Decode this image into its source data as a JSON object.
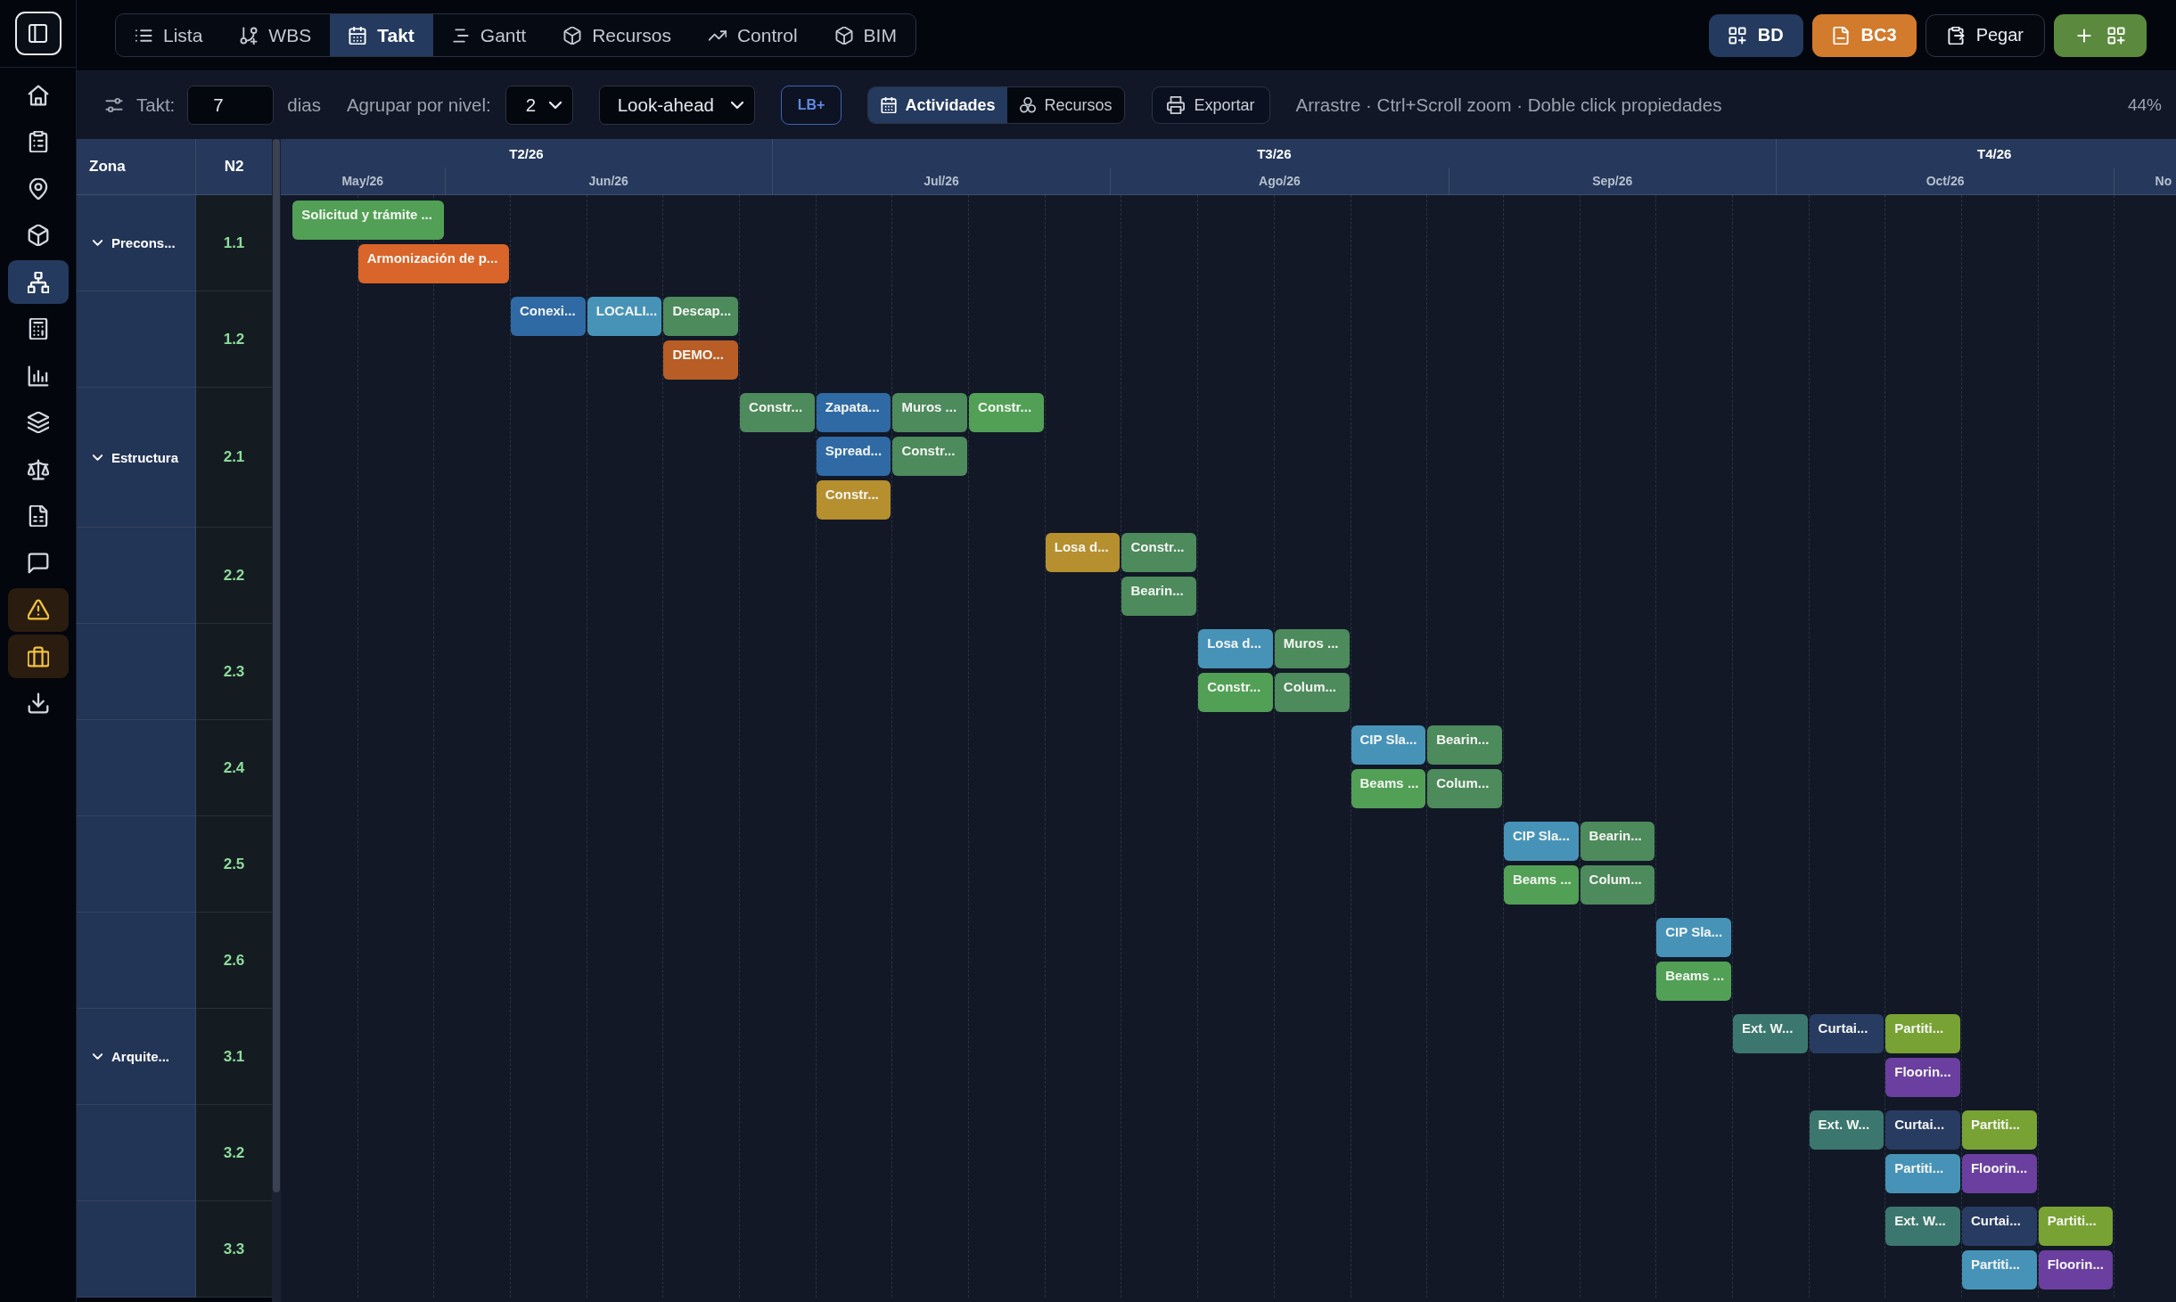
{
  "sidebar": {
    "items": [
      {
        "selected": false,
        "highlighted": false
      },
      {
        "selected": false,
        "highlighted": false
      },
      {
        "selected": false,
        "highlighted": false
      },
      {
        "selected": false,
        "highlighted": false
      },
      {
        "selected": true,
        "highlighted": false
      },
      {
        "selected": false,
        "highlighted": false
      },
      {
        "selected": false,
        "highlighted": false
      },
      {
        "selected": false,
        "highlighted": false
      },
      {
        "selected": false,
        "highlighted": false
      },
      {
        "selected": false,
        "highlighted": false
      },
      {
        "selected": false,
        "highlighted": false
      },
      {
        "selected": false,
        "highlighted": true
      },
      {
        "selected": false,
        "highlighted": true
      },
      {
        "selected": false,
        "highlighted": false
      }
    ]
  },
  "top_bar": {
    "tabs": [
      {
        "label": "Lista",
        "selected": false
      },
      {
        "label": "WBS",
        "selected": false
      },
      {
        "label": "Takt",
        "selected": true
      },
      {
        "label": "Gantt",
        "selected": false
      },
      {
        "label": "Recursos",
        "selected": false
      },
      {
        "label": "Control",
        "selected": false
      },
      {
        "label": "BIM",
        "selected": false
      }
    ],
    "actions": [
      {
        "kind": "database",
        "label": "BD"
      },
      {
        "kind": "file",
        "label": "BC3"
      },
      {
        "kind": "paste",
        "label": "Pegar"
      },
      {
        "kind": "add"
      }
    ]
  },
  "toolbar": {
    "takt": {
      "label": "Takt:",
      "value": "7",
      "unit": "dias"
    },
    "group_level": {
      "label": "Agrupar por nivel:",
      "value": "2"
    },
    "view_select": {
      "value": "Look-ahead"
    },
    "baseline_button": "LB+",
    "mode_toggle": [
      {
        "label": "Actividades",
        "selected": true
      },
      {
        "label": "Recursos",
        "selected": false
      }
    ],
    "export_button": "Exportar",
    "hint": "Arrastre · Ctrl+Scroll zoom · Doble click propiedades",
    "zoom": "44%"
  },
  "gantt": {
    "zone_header": "Zona",
    "level_header": "N2",
    "quarters": [
      "T2/26",
      "T3/26",
      "T4/26"
    ],
    "months": [
      "May/26",
      "Jun/26",
      "Jul/26",
      "Ago/26",
      "Sep/26",
      "Oct/26",
      "No"
    ],
    "groups": [
      {
        "zone": "Precons...",
        "expanded": true,
        "rows": [
          {
            "code": "1.1",
            "lanes": [
              {
                "bars": [
                  {
                    "label": "Solicitud y trámite ...",
                    "color": "#52a056"
                  }
                ]
              },
              {
                "bars": [
                  {
                    "label": "Armonización de p...",
                    "color": "#d9652a"
                  }
                ]
              }
            ]
          },
          {
            "code": "1.2",
            "lanes": [
              {
                "bars": [
                  {
                    "label": "Conexi...",
                    "color": "#2f6aa5"
                  },
                  {
                    "label": "LOCALI...",
                    "color": "#4793b8"
                  },
                  {
                    "label": "Descap...",
                    "color": "#4d8a5c"
                  }
                ]
              },
              {
                "bars": [
                  {
                    "label": "DEMO...",
                    "color": "#b85d26"
                  }
                ]
              }
            ]
          }
        ]
      },
      {
        "zone": "Estructura",
        "expanded": true,
        "rows": [
          {
            "code": "2.1",
            "lanes": [
              {
                "bars": [
                  {
                    "label": "Constr...",
                    "color": "#4d8a5c"
                  },
                  {
                    "label": "Zapata...",
                    "color": "#2f6aa5"
                  },
                  {
                    "label": "Muros ...",
                    "color": "#4d8a5c"
                  },
                  {
                    "label": "Constr...",
                    "color": "#52a056"
                  }
                ]
              },
              {
                "bars": [
                  {
                    "label": "Spread...",
                    "color": "#2f6aa5"
                  },
                  {
                    "label": "Constr...",
                    "color": "#4d8a5c"
                  }
                ]
              },
              {
                "bars": [
                  {
                    "label": "Constr...",
                    "color": "#b68f2f"
                  }
                ]
              }
            ]
          },
          {
            "code": "2.2",
            "lanes": [
              {
                "bars": [
                  {
                    "label": "Losa d...",
                    "color": "#b68f2f"
                  },
                  {
                    "label": "Constr...",
                    "color": "#4d8a5c"
                  }
                ]
              },
              {
                "bars": [
                  {
                    "label": "Bearin...",
                    "color": "#4d8a5c"
                  }
                ]
              }
            ]
          },
          {
            "code": "2.3",
            "lanes": [
              {
                "bars": [
                  {
                    "label": "Losa d...",
                    "color": "#4793b8"
                  },
                  {
                    "label": "Muros ...",
                    "color": "#4d8a5c"
                  }
                ]
              },
              {
                "bars": [
                  {
                    "label": "Constr...",
                    "color": "#52a056"
                  },
                  {
                    "label": "Colum...",
                    "color": "#4d8a5c"
                  }
                ]
              }
            ]
          },
          {
            "code": "2.4",
            "lanes": [
              {
                "bars": [
                  {
                    "label": "CIP Sla...",
                    "color": "#4793b8"
                  },
                  {
                    "label": "Bearin...",
                    "color": "#4d8a5c"
                  }
                ]
              },
              {
                "bars": [
                  {
                    "label": "Beams ...",
                    "color": "#52a056"
                  },
                  {
                    "label": "Colum...",
                    "color": "#4d8a5c"
                  }
                ]
              }
            ]
          },
          {
            "code": "2.5",
            "lanes": [
              {
                "bars": [
                  {
                    "label": "CIP Sla...",
                    "color": "#4793b8"
                  },
                  {
                    "label": "Bearin...",
                    "color": "#4d8a5c"
                  }
                ]
              },
              {
                "bars": [
                  {
                    "label": "Beams ...",
                    "color": "#52a056"
                  },
                  {
                    "label": "Colum...",
                    "color": "#4d8a5c"
                  }
                ]
              }
            ]
          },
          {
            "code": "2.6",
            "lanes": [
              {
                "bars": [
                  {
                    "label": "CIP Sla...",
                    "color": "#4793b8"
                  }
                ]
              },
              {
                "bars": [
                  {
                    "label": "Beams ...",
                    "color": "#52a056"
                  }
                ]
              }
            ]
          }
        ]
      },
      {
        "zone": "Arquite...",
        "expanded": true,
        "rows": [
          {
            "code": "3.1",
            "lanes": [
              {
                "bars": [
                  {
                    "label": "Ext. W...",
                    "color": "#3c776f"
                  },
                  {
                    "label": "Curtai...",
                    "color": "#283c62"
                  },
                  {
                    "label": "Partiti...",
                    "color": "#78a234"
                  }
                ]
              },
              {
                "bars": [
                  {
                    "label": "Floorin...",
                    "color": "#6b3f9f"
                  }
                ]
              }
            ]
          },
          {
            "code": "3.2",
            "lanes": [
              {
                "bars": [
                  {
                    "label": "Ext. W...",
                    "color": "#3c776f"
                  },
                  {
                    "label": "Curtai...",
                    "color": "#283c62"
                  },
                  {
                    "label": "Partiti...",
                    "color": "#78a234"
                  }
                ]
              },
              {
                "bars": [
                  {
                    "label": "Partiti...",
                    "color": "#4793b8"
                  },
                  {
                    "label": "Floorin...",
                    "color": "#6b3f9f"
                  }
                ]
              }
            ]
          },
          {
            "code": "3.3",
            "lanes": [
              {
                "bars": [
                  {
                    "label": "Ext. W...",
                    "color": "#3c776f"
                  },
                  {
                    "label": "Curtai...",
                    "color": "#283c62"
                  },
                  {
                    "label": "Partiti...",
                    "color": "#78a234"
                  }
                ]
              },
              {
                "bars": [
                  {
                    "label": "Partiti...",
                    "color": "#4793b8"
                  },
                  {
                    "label": "Floorin...",
                    "color": "#6b3f9f"
                  }
                ]
              }
            ]
          }
        ]
      }
    ]
  }
}
